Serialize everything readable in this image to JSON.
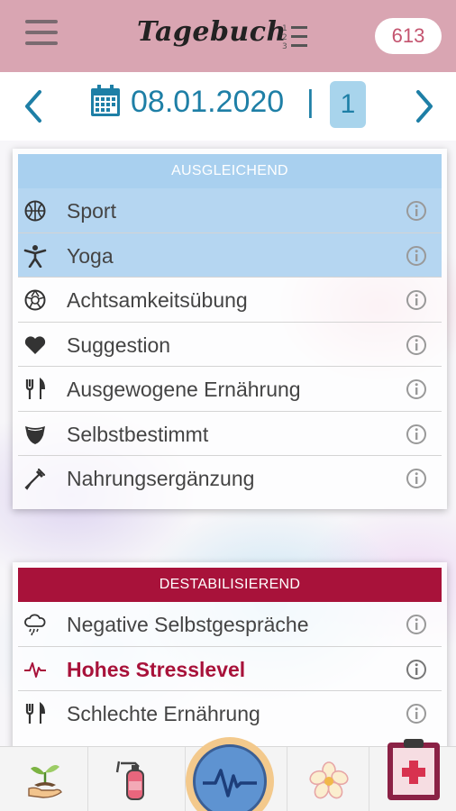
{
  "header": {
    "title": "Tagebuch",
    "counter": "613"
  },
  "datebar": {
    "date": "08.01.2020",
    "separator": "|",
    "day_index": "1"
  },
  "positive": {
    "title": "AUSGLEICHEND",
    "color": "#a9d0ef",
    "items": [
      {
        "label": "Sport",
        "icon": "basketball-icon",
        "selected": true
      },
      {
        "label": "Yoga",
        "icon": "person-stretch-icon",
        "selected": true
      },
      {
        "label": "Achtsamkeitsübung",
        "icon": "aperture-icon",
        "selected": false
      },
      {
        "label": "Suggestion",
        "icon": "heart-icon",
        "selected": false
      },
      {
        "label": "Ausgewogene Ernährung",
        "icon": "fork-knife-icon",
        "selected": false
      },
      {
        "label": "Selbstbestimmt",
        "icon": "shield-icon",
        "selected": false
      },
      {
        "label": "Nahrungsergänzung",
        "icon": "dropper-icon",
        "selected": false
      }
    ]
  },
  "negative": {
    "title": "DESTABILISIEREND",
    "color": "#a8123a",
    "items": [
      {
        "label": "Negative Selbstgespräche",
        "icon": "cloud-rain-icon"
      },
      {
        "label": "Hohes Stresslevel",
        "icon": "heartbeat-line-icon",
        "highlighted": true
      },
      {
        "label": "Schlechte Ernährung",
        "icon": "fork-knife-icon"
      }
    ]
  },
  "bottom_nav": [
    {
      "icon": "plant-hand-icon"
    },
    {
      "icon": "fire-extinguisher-icon"
    },
    {
      "icon": "heartbeat-circle-icon",
      "active": true
    },
    {
      "icon": "flower-icon"
    },
    {
      "icon": "medical-clipboard-icon"
    }
  ]
}
